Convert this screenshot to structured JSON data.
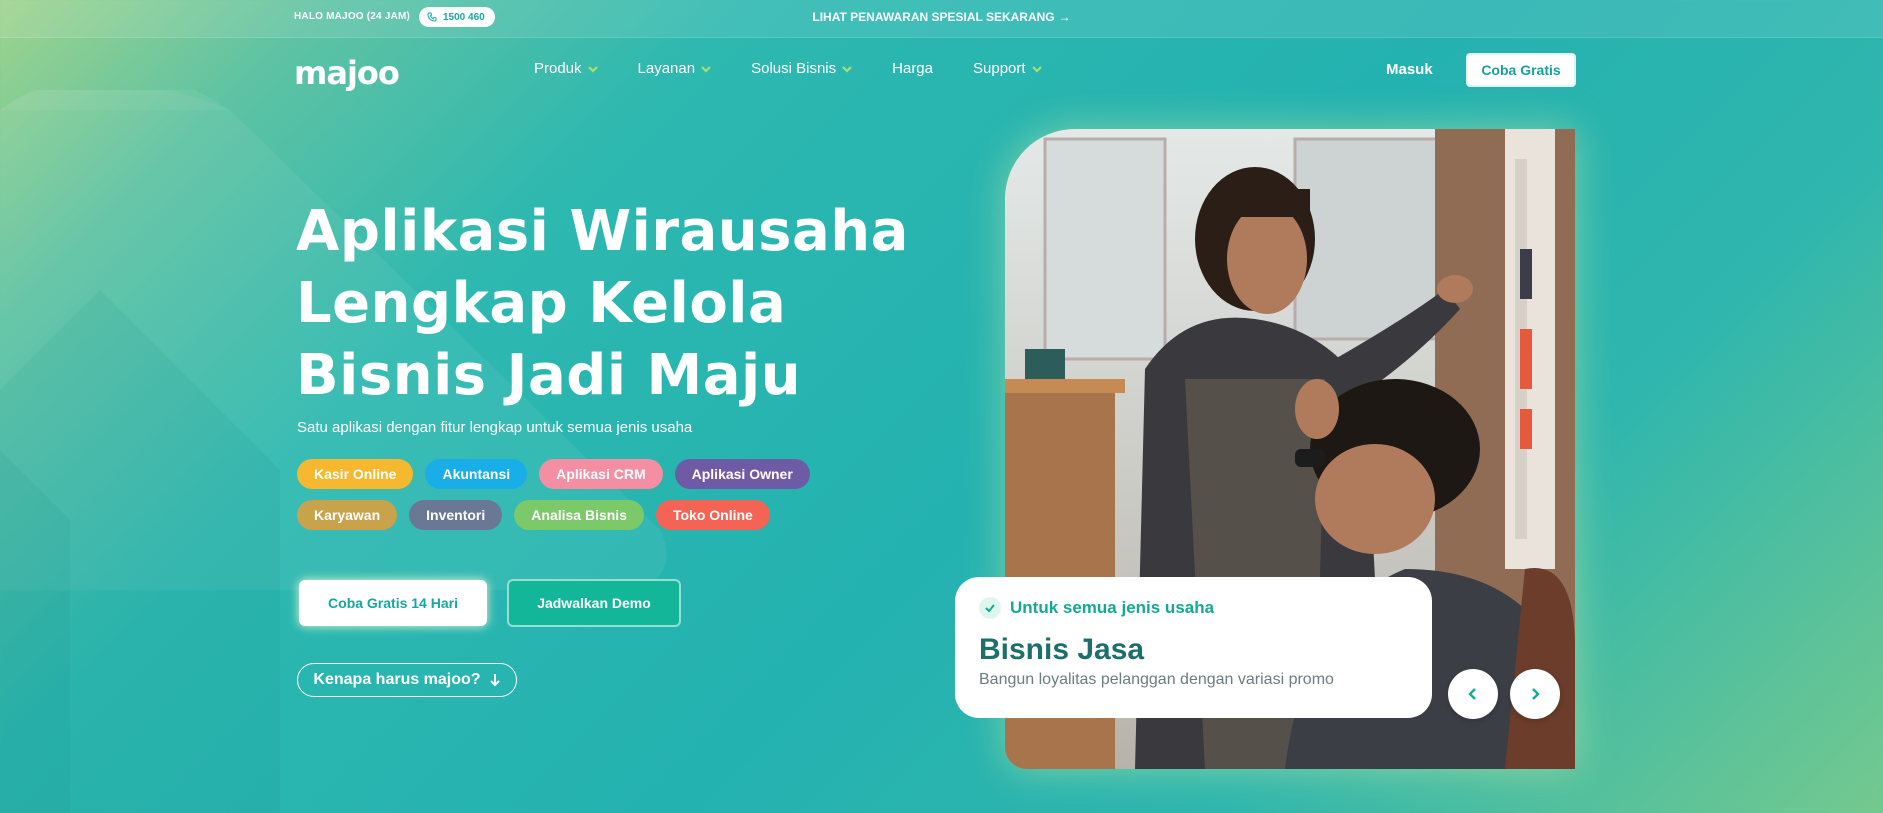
{
  "topbar": {
    "hello": "HALO MAJOO (24 JAM)",
    "phone": "1500 460",
    "promo": "LIHAT PENAWARAN SPESIAL SEKARANG"
  },
  "header": {
    "logo": "majoo",
    "nav": [
      {
        "label": "Produk",
        "has_dropdown": true
      },
      {
        "label": "Layanan",
        "has_dropdown": true
      },
      {
        "label": "Solusi Bisnis",
        "has_dropdown": true
      },
      {
        "label": "Harga",
        "has_dropdown": false
      },
      {
        "label": "Support",
        "has_dropdown": true
      }
    ],
    "login": "Masuk",
    "try_free": "Coba Gratis"
  },
  "hero": {
    "headline_lines": [
      "Aplikasi Wirausaha",
      "Lengkap Kelola",
      "Bisnis Jadi Maju"
    ],
    "subtitle": "Satu aplikasi dengan fitur lengkap untuk semua jenis usaha",
    "features": [
      {
        "label": "Kasir Online",
        "color": "#f5b82e"
      },
      {
        "label": "Akuntansi",
        "color": "#1aaee8"
      },
      {
        "label": "Aplikasi CRM",
        "color": "#f48ea2"
      },
      {
        "label": "Aplikasi Owner",
        "color": "#6e5ba6"
      },
      {
        "label": "Karyawan",
        "color": "#c9a24c"
      },
      {
        "label": "Inventori",
        "color": "#6a7896"
      },
      {
        "label": "Analisa Bisnis",
        "color": "#7cc96a"
      },
      {
        "label": "Toko Online",
        "color": "#f36455"
      }
    ],
    "cta_primary": "Coba Gratis 14 Hari",
    "cta_secondary": "Jadwalkan Demo",
    "why": "Kenapa harus majoo?"
  },
  "carousel": {
    "tagline": "Untuk semua jenis usaha",
    "title": "Bisnis Jasa",
    "description": "Bangun loyalitas pelanggan dengan variasi promo"
  },
  "colors": {
    "accent": "#17a59f",
    "card_title": "#1d6f69",
    "card_tag": "#13aa93"
  }
}
